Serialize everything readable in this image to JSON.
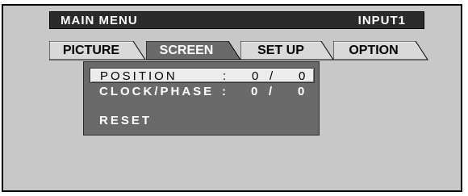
{
  "header": {
    "title": "MAIN  MENU",
    "input": "INPUT1"
  },
  "tabs": [
    {
      "label": "PICTURE",
      "active": false
    },
    {
      "label": "SCREEN",
      "active": true
    },
    {
      "label": "SET UP",
      "active": false
    },
    {
      "label": "OPTION",
      "active": false
    }
  ],
  "menu": {
    "position": {
      "label": "POSITION",
      "sep": ":",
      "value1": "0",
      "slash": "/",
      "value2": "0"
    },
    "clock_phase": {
      "label": "CLOCK/PHASE",
      "sep": ":",
      "value1": "0",
      "slash": "/",
      "value2": "0"
    },
    "reset": {
      "label": "RESET"
    }
  },
  "colors": {
    "screen_bg": "#c8c8c8",
    "title_bg": "#2b2b2b",
    "panel_bg": "#6a6a6a",
    "active_tab": "#6a6a6a",
    "inactive_tab": "#d9d9d9"
  }
}
